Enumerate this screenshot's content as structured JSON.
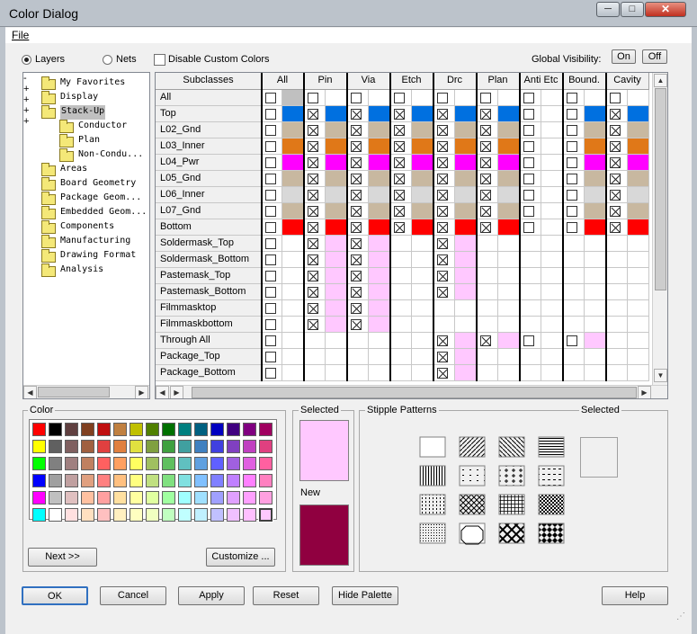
{
  "window": {
    "title": "Color Dialog",
    "min": "─",
    "max": "□",
    "close": "✕"
  },
  "menu": {
    "file": "File"
  },
  "top": {
    "layers_label": "Layers",
    "nets_label": "Nets",
    "disable_custom_label": "Disable Custom Colors",
    "global_visibility_label": "Global Visibility:",
    "on_label": "On",
    "off_label": "Off"
  },
  "tree": [
    {
      "label": "My Favorites",
      "level": 0,
      "expander": ""
    },
    {
      "label": "Display",
      "level": 0,
      "expander": ""
    },
    {
      "label": "Stack-Up",
      "level": 0,
      "expander": "-",
      "selected": true
    },
    {
      "label": "Conductor",
      "level": 1,
      "expander": "+"
    },
    {
      "label": "Plan",
      "level": 1,
      "expander": ""
    },
    {
      "label": "Non-Condu...",
      "level": 1,
      "expander": "+"
    },
    {
      "label": "Areas",
      "level": 0,
      "expander": "+"
    },
    {
      "label": "Board Geometry",
      "level": 0,
      "expander": ""
    },
    {
      "label": "Package Geom...",
      "level": 0,
      "expander": ""
    },
    {
      "label": "Embedded Geom...",
      "level": 0,
      "expander": ""
    },
    {
      "label": "Components",
      "level": 0,
      "expander": "+"
    },
    {
      "label": "Manufacturing",
      "level": 0,
      "expander": ""
    },
    {
      "label": "Drawing Format",
      "level": 0,
      "expander": ""
    },
    {
      "label": "Analysis",
      "level": 0,
      "expander": ""
    }
  ],
  "grid": {
    "subclasses_header": "Subclasses",
    "columns": [
      "All",
      "Pin",
      "Via",
      "Etch",
      "Drc",
      "Plan",
      "Anti Etc",
      "Bound.",
      "Cavity"
    ],
    "rows": [
      {
        "name": "All",
        "color": "#c0c0c0",
        "cells": [
          1,
          1,
          1,
          1,
          1,
          1,
          1,
          1,
          1
        ],
        "x": [
          0,
          0,
          0,
          0,
          0,
          0,
          0,
          0,
          0
        ],
        "colored": [
          1,
          0,
          0,
          0,
          0,
          0,
          0,
          0,
          0
        ]
      },
      {
        "name": "Top",
        "color": "#0070e0",
        "cells": [
          1,
          1,
          1,
          1,
          1,
          1,
          1,
          1,
          1
        ],
        "x": [
          0,
          1,
          1,
          1,
          1,
          1,
          0,
          0,
          1
        ],
        "colored": [
          1,
          1,
          1,
          1,
          1,
          1,
          0,
          1,
          1
        ]
      },
      {
        "name": "L02_Gnd",
        "color": "#c8b8a0",
        "cells": [
          1,
          1,
          1,
          1,
          1,
          1,
          1,
          1,
          1
        ],
        "x": [
          0,
          1,
          1,
          1,
          1,
          1,
          0,
          0,
          1
        ],
        "colored": [
          1,
          1,
          1,
          1,
          1,
          1,
          0,
          1,
          1
        ]
      },
      {
        "name": "L03_Inner",
        "color": "#e07818",
        "cells": [
          1,
          1,
          1,
          1,
          1,
          1,
          1,
          1,
          1
        ],
        "x": [
          0,
          1,
          1,
          1,
          1,
          1,
          0,
          0,
          1
        ],
        "colored": [
          1,
          1,
          1,
          1,
          1,
          1,
          0,
          1,
          1
        ]
      },
      {
        "name": "L04_Pwr",
        "color": "#ff00ff",
        "cells": [
          1,
          1,
          1,
          1,
          1,
          1,
          1,
          1,
          1
        ],
        "x": [
          0,
          1,
          1,
          1,
          1,
          1,
          0,
          0,
          1
        ],
        "colored": [
          1,
          1,
          1,
          1,
          1,
          1,
          0,
          1,
          1
        ]
      },
      {
        "name": "L05_Gnd",
        "color": "#c8b8a0",
        "cells": [
          1,
          1,
          1,
          1,
          1,
          1,
          1,
          1,
          1
        ],
        "x": [
          0,
          1,
          1,
          1,
          1,
          1,
          0,
          0,
          1
        ],
        "colored": [
          1,
          1,
          1,
          1,
          1,
          1,
          0,
          1,
          1
        ]
      },
      {
        "name": "L06_Inner",
        "color": "#d8d8d8",
        "cells": [
          1,
          1,
          1,
          1,
          1,
          1,
          1,
          1,
          1
        ],
        "x": [
          0,
          1,
          1,
          1,
          1,
          1,
          0,
          0,
          1
        ],
        "colored": [
          1,
          1,
          1,
          1,
          1,
          1,
          0,
          1,
          1
        ]
      },
      {
        "name": "L07_Gnd",
        "color": "#c8b8a0",
        "cells": [
          1,
          1,
          1,
          1,
          1,
          1,
          1,
          1,
          1
        ],
        "x": [
          0,
          1,
          1,
          1,
          1,
          1,
          0,
          0,
          1
        ],
        "colored": [
          1,
          1,
          1,
          1,
          1,
          1,
          0,
          1,
          1
        ]
      },
      {
        "name": "Bottom",
        "color": "#ff0000",
        "cells": [
          1,
          1,
          1,
          1,
          1,
          1,
          1,
          1,
          1
        ],
        "x": [
          0,
          1,
          1,
          1,
          1,
          1,
          0,
          0,
          1
        ],
        "colored": [
          1,
          1,
          1,
          1,
          1,
          1,
          0,
          1,
          1
        ]
      },
      {
        "name": "Soldermask_Top",
        "color": "#ffc8ff",
        "cells": [
          1,
          1,
          1,
          0,
          1,
          0,
          0,
          0,
          0
        ],
        "x": [
          0,
          1,
          1,
          0,
          1,
          0,
          0,
          0,
          0
        ],
        "colored": [
          0,
          1,
          1,
          0,
          1,
          0,
          0,
          0,
          0
        ]
      },
      {
        "name": "Soldermask_Bottom",
        "color": "#ffc8ff",
        "cells": [
          1,
          1,
          1,
          0,
          1,
          0,
          0,
          0,
          0
        ],
        "x": [
          0,
          1,
          1,
          0,
          1,
          0,
          0,
          0,
          0
        ],
        "colored": [
          0,
          1,
          1,
          0,
          1,
          0,
          0,
          0,
          0
        ]
      },
      {
        "name": "Pastemask_Top",
        "color": "#ffc8ff",
        "cells": [
          1,
          1,
          1,
          0,
          1,
          0,
          0,
          0,
          0
        ],
        "x": [
          0,
          1,
          1,
          0,
          1,
          0,
          0,
          0,
          0
        ],
        "colored": [
          0,
          1,
          1,
          0,
          1,
          0,
          0,
          0,
          0
        ]
      },
      {
        "name": "Pastemask_Bottom",
        "color": "#ffc8ff",
        "cells": [
          1,
          1,
          1,
          0,
          1,
          0,
          0,
          0,
          0
        ],
        "x": [
          0,
          1,
          1,
          0,
          1,
          0,
          0,
          0,
          0
        ],
        "colored": [
          0,
          1,
          1,
          0,
          1,
          0,
          0,
          0,
          0
        ]
      },
      {
        "name": "Filmmasktop",
        "color": "#ffc8ff",
        "cells": [
          1,
          1,
          1,
          0,
          0,
          0,
          0,
          0,
          0
        ],
        "x": [
          0,
          1,
          1,
          0,
          0,
          0,
          0,
          0,
          0
        ],
        "colored": [
          0,
          1,
          1,
          0,
          0,
          0,
          0,
          0,
          0
        ]
      },
      {
        "name": "Filmmaskbottom",
        "color": "#ffc8ff",
        "cells": [
          1,
          1,
          1,
          0,
          0,
          0,
          0,
          0,
          0
        ],
        "x": [
          0,
          1,
          1,
          0,
          0,
          0,
          0,
          0,
          0
        ],
        "colored": [
          0,
          1,
          1,
          0,
          0,
          0,
          0,
          0,
          0
        ]
      },
      {
        "name": "Through All",
        "color": "#ffc8ff",
        "cells": [
          1,
          0,
          0,
          0,
          1,
          1,
          1,
          1,
          0
        ],
        "x": [
          0,
          0,
          0,
          0,
          1,
          1,
          0,
          0,
          0
        ],
        "colored": [
          0,
          0,
          0,
          0,
          1,
          1,
          0,
          1,
          0
        ]
      },
      {
        "name": "Package_Top",
        "color": "#ffc8ff",
        "cells": [
          1,
          0,
          0,
          0,
          1,
          0,
          0,
          0,
          0
        ],
        "x": [
          0,
          0,
          0,
          0,
          1,
          0,
          0,
          0,
          0
        ],
        "colored": [
          0,
          0,
          0,
          0,
          1,
          0,
          0,
          0,
          0
        ]
      },
      {
        "name": "Package_Bottom",
        "color": "#ffc8ff",
        "cells": [
          1,
          0,
          0,
          0,
          1,
          0,
          0,
          0,
          0
        ],
        "x": [
          0,
          0,
          0,
          0,
          1,
          0,
          0,
          0,
          0
        ],
        "colored": [
          0,
          0,
          0,
          0,
          1,
          0,
          0,
          0,
          0
        ]
      }
    ]
  },
  "color_panel": {
    "label": "Color",
    "next_label": "Next >>",
    "customize_label": "Customize ...",
    "palette": [
      [
        "#ff0000",
        "#000000",
        "#604040",
        "#804020",
        "#c01010",
        "#c08040",
        "#c0c000",
        "#508000",
        "#007000",
        "#008080",
        "#006080",
        "#0000c0",
        "#400080",
        "#800080",
        "#a00060"
      ],
      [
        "#ffff00",
        "#606060",
        "#806060",
        "#a06040",
        "#e04040",
        "#e08040",
        "#e0e040",
        "#80a040",
        "#40a040",
        "#40a0a0",
        "#4080c0",
        "#4040e0",
        "#8040c0",
        "#c040c0",
        "#e04080"
      ],
      [
        "#00ff00",
        "#808080",
        "#a08080",
        "#c08060",
        "#ff6060",
        "#ffa060",
        "#ffff60",
        "#a0c060",
        "#60c060",
        "#60c0c0",
        "#60a0e0",
        "#6060ff",
        "#a060e0",
        "#e060e0",
        "#ff60a0"
      ],
      [
        "#0000ff",
        "#a0a0a0",
        "#c0a0a0",
        "#e0a080",
        "#ff8080",
        "#ffc080",
        "#ffff80",
        "#c0e080",
        "#80e080",
        "#80e0e0",
        "#80c0ff",
        "#8080ff",
        "#c080ff",
        "#ff80ff",
        "#ff80c0"
      ],
      [
        "#ff00ff",
        "#c0c0c0",
        "#e0c0c0",
        "#ffc0a0",
        "#ffa0a0",
        "#ffe0a0",
        "#ffffa0",
        "#e0ffa0",
        "#a0ffa0",
        "#a0ffff",
        "#a0e0ff",
        "#a0a0ff",
        "#e0a0ff",
        "#ffa0ff",
        "#ffa0e0"
      ],
      [
        "#00ffff",
        "#ffffff",
        "#ffe0e0",
        "#ffe0c0",
        "#ffc0c0",
        "#fff0c0",
        "#ffffc0",
        "#f0ffc0",
        "#c0ffc0",
        "#c0ffff",
        "#c0f0ff",
        "#c0c0ff",
        "#f0c0ff",
        "#ffc0ff",
        "#ffc8ff"
      ]
    ]
  },
  "selected_panel": {
    "label": "Selected",
    "selected_color": "#ffc8ff",
    "new_label": "New",
    "new_color": "#900040"
  },
  "stipple": {
    "label": "Stipple Patterns",
    "selected_label": "Selected"
  },
  "buttons": {
    "ok": "OK",
    "cancel": "Cancel",
    "apply": "Apply",
    "reset": "Reset",
    "hide_palette": "Hide Palette",
    "help": "Help"
  }
}
